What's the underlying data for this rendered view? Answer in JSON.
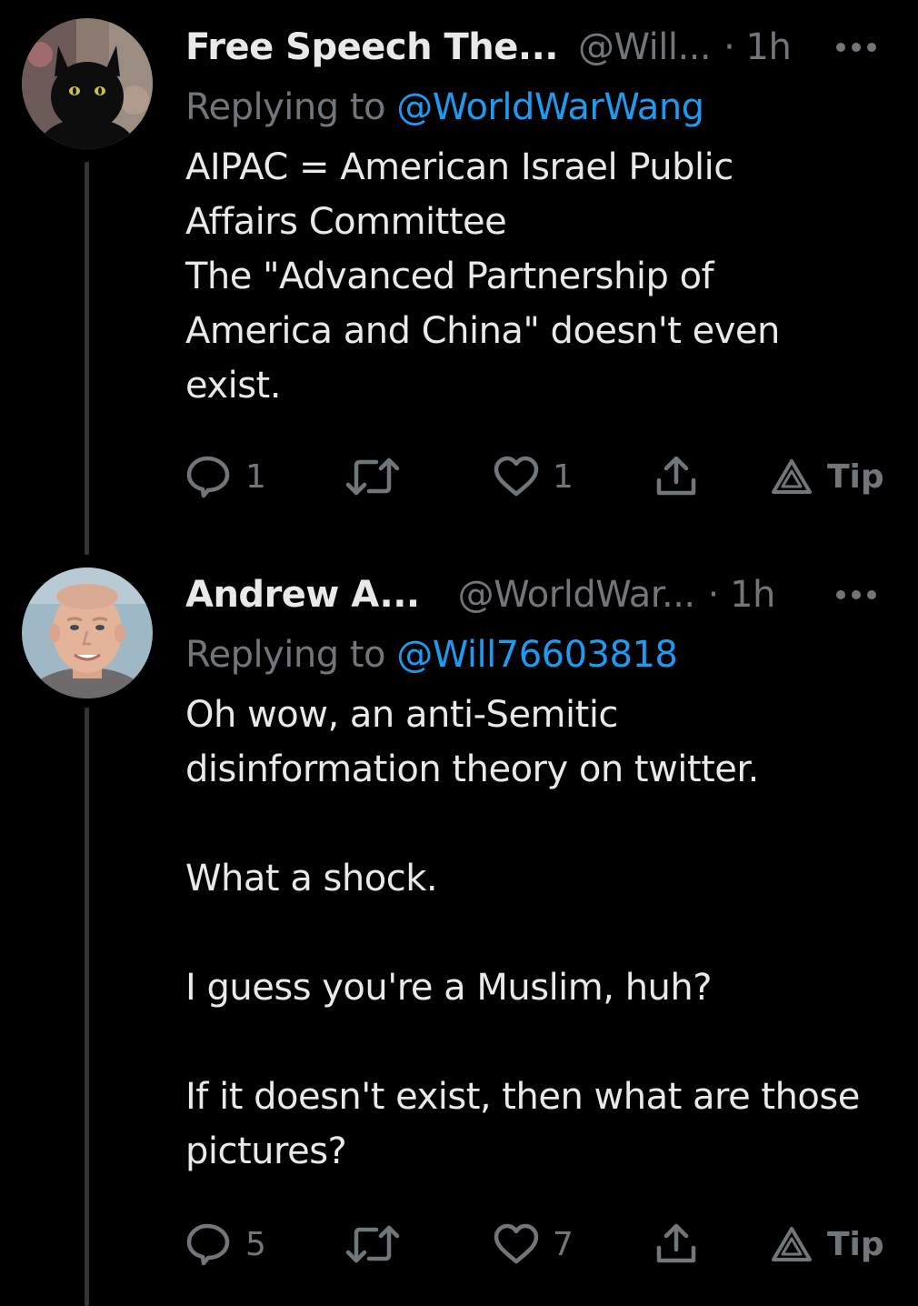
{
  "colors": {
    "background": "#000000",
    "text_primary": "#e7e9ea",
    "text_secondary": "#71767b",
    "link": "#1d9bf0",
    "thread_line": "#333639"
  },
  "tweets": [
    {
      "display_name": "Free Speech The...",
      "handle": "@Will...",
      "time": "· 1h",
      "replying_prefix": "Replying to ",
      "replying_to": "@WorldWarWang",
      "avatar_icon": "black-cat-avatar",
      "lines": [
        "AIPAC = American Israel Public",
        "Affairs Committee",
        "The \"Advanced Partnership of",
        "America and China\" doesn't even",
        "exist."
      ],
      "reply_count": "1",
      "like_count": "1",
      "tip_label": "Tip"
    },
    {
      "display_name": "Andrew A...",
      "handle": "@WorldWar...",
      "time": "· 1h",
      "replying_prefix": "Replying to ",
      "replying_to": "@Will76603818",
      "avatar_icon": "man-portrait-avatar",
      "lines": [
        "Oh wow, an anti-Semitic",
        "disinformation theory on twitter.",
        "",
        "What a shock.",
        "",
        "I guess you're a Muslim, huh?",
        "",
        "If it doesn't exist, then what are those",
        "pictures?"
      ],
      "reply_count": "5",
      "like_count": "7",
      "tip_label": "Tip"
    }
  ]
}
